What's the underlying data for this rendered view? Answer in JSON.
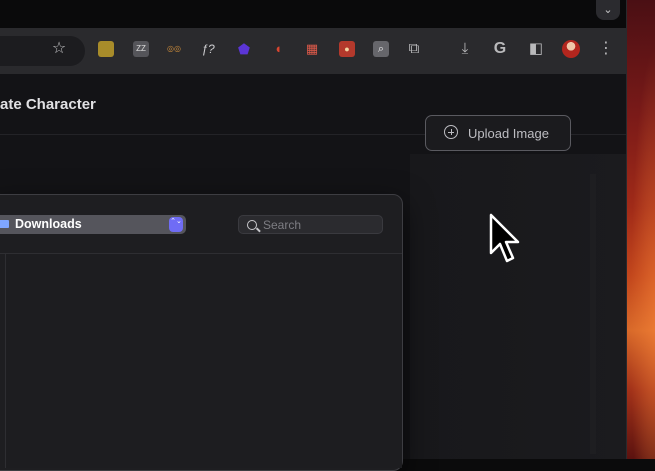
{
  "wallpaper": "macos-sonoma-orange",
  "browser": {
    "tab_dropdown_icon": "⌄",
    "toolbar": {
      "bookmark_icon": "☆",
      "extensions": [
        {
          "name": "ext-yellow",
          "text": "",
          "color": "#c9a227"
        },
        {
          "name": "ext-zz",
          "text": "ZZ",
          "color": "#5a5a5e"
        },
        {
          "name": "ext-goggles",
          "text": "◎◎",
          "color": "#2a2a2d"
        },
        {
          "name": "ext-fx",
          "text": "ƒ?",
          "color": "#2a2a2d"
        },
        {
          "name": "ext-purple-shield",
          "text": "⬟",
          "color": "#4b2bbd"
        },
        {
          "name": "ext-red-curve",
          "text": "◖",
          "color": "#2a2a2d"
        },
        {
          "name": "ext-red-grid",
          "text": "▦",
          "color": "#c0392b"
        },
        {
          "name": "ext-red-badge",
          "text": "●",
          "color": "#b03a2e"
        },
        {
          "name": "ext-gray-search",
          "text": "⌕",
          "color": "#6d6d72"
        }
      ],
      "puzzle_icon": "⧉",
      "download_icon": "⤓",
      "google_icon": "G",
      "sidepanel_icon": "◧",
      "menu_icon": "⋮"
    }
  },
  "app": {
    "page_title": "ate Character",
    "upload_button_label": "Upload Image"
  },
  "file_dialog": {
    "location_label": "Downloads",
    "stepper_icon": "⌃⌄",
    "search_placeholder": "Search",
    "search_value": ""
  }
}
